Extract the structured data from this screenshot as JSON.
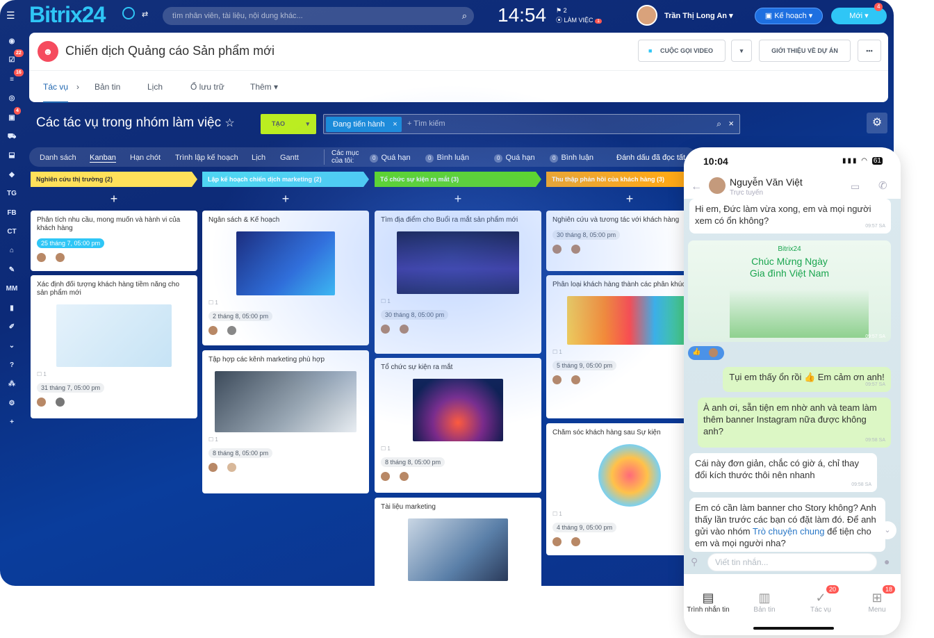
{
  "header": {
    "logo": "Bitrix24",
    "search_placeholder": "tìm nhân viên, tài liệu, nội dung khác...",
    "time": "14:54",
    "flag_count": "2",
    "workday": "LÀM VIỆC",
    "workday_badge": "1",
    "user_name": "Trần Thị Long An",
    "plan_label": "Kế hoạch",
    "new_label": "Mới",
    "new_badge": "4"
  },
  "sidebar": {
    "items": [
      {
        "label": "",
        "icon": "logo-icon"
      },
      {
        "label": "",
        "icon": "tasks-icon",
        "badge": "22"
      },
      {
        "label": "",
        "icon": "feed-icon",
        "badge": "16"
      },
      {
        "label": "",
        "icon": "target-icon"
      },
      {
        "label": "",
        "icon": "contacts-icon",
        "badge": "4"
      },
      {
        "label": "",
        "icon": "cart-icon"
      },
      {
        "label": "",
        "icon": "robot-icon"
      },
      {
        "label": "",
        "icon": "box-icon"
      },
      {
        "label": "TG"
      },
      {
        "label": "FB"
      },
      {
        "label": "CT"
      },
      {
        "label": "",
        "icon": "bank-icon"
      },
      {
        "label": "",
        "icon": "sign-icon"
      },
      {
        "label": "MM"
      },
      {
        "label": "",
        "icon": "chart-icon"
      },
      {
        "label": "",
        "icon": "edit-icon"
      },
      {
        "label": "",
        "icon": "chevron-icon"
      },
      {
        "label": "",
        "icon": "help-icon"
      },
      {
        "label": "",
        "icon": "network-icon"
      },
      {
        "label": "",
        "icon": "gear-icon"
      },
      {
        "label": "",
        "icon": "plus-icon"
      }
    ]
  },
  "group": {
    "title": "Chiến dịch Quảng cáo Sản phẩm mới",
    "video_call": "CUỘC GỌI VIDEO",
    "intro": "GIỚI THIỆU VỀ DỰ ÁN",
    "more": "•••",
    "tabs": [
      "Tác vụ",
      "Bản tin",
      "Lịch",
      "Ổ lưu trữ",
      "Thêm"
    ]
  },
  "tasks": {
    "title": "Các tác vụ trong nhóm làm việc",
    "create": "TẠO",
    "filter_chip": "Đang tiến hành",
    "filter_placeholder": "+ Tìm kiếm"
  },
  "views": {
    "items": [
      "Danh sách",
      "Kanban",
      "Hạn chót",
      "Trình lập kế hoạch",
      "Lịch",
      "Gantt"
    ],
    "my_items": "Các mục\ncủa tôi:",
    "counters": [
      {
        "num": "0",
        "label": "Quá hạn"
      },
      {
        "num": "0",
        "label": "Bình luận"
      },
      {
        "num": "0",
        "label": "Quá hạn"
      },
      {
        "num": "0",
        "label": "Bình luận"
      }
    ],
    "mark_read": "Đánh dấu đã đọc tất"
  },
  "columns": [
    {
      "title": "Nghiên cứu thị trường",
      "count": "(2)",
      "color": "#ffe15a",
      "cards": [
        {
          "title": "Phân tích nhu cầu, mong muốn và hành vi của khách hàng",
          "deadline": "25 tháng 7, 05:00 pm",
          "hot": true
        },
        {
          "title": "Xác định đối tượng khách hàng tiềm năng cho sản phẩm mới",
          "check": "1",
          "deadline": "31 tháng 7, 05:00 pm"
        }
      ]
    },
    {
      "title": "Lập kế hoạch chiến dịch marketing",
      "count": "(2)",
      "color": "#4fd5f2",
      "cards": [
        {
          "title": "Ngân sách & Kế hoạch",
          "check": "1",
          "deadline": "2 tháng 8, 05:00 pm"
        },
        {
          "title": "Tập hợp các kênh marketing phù hợp",
          "check": "1",
          "deadline": "8 tháng 8, 05:00 pm"
        }
      ]
    },
    {
      "title": "Tổ chức sự kiện ra mắt",
      "count": "(3)",
      "color": "#5fe010",
      "cards": [
        {
          "title": "Tìm địa điểm cho Buổi ra mắt sản phẩm mới",
          "check": "1",
          "deadline": "30 tháng 8, 05:00 pm"
        },
        {
          "title": "Tổ chức sự kiện ra mắt",
          "check": "1",
          "deadline": "8 tháng 8, 05:00 pm"
        },
        {
          "title": "Tài liệu marketing"
        }
      ]
    },
    {
      "title": "Thu thập phản hồi của khách hàng",
      "count": "(3)",
      "color": "#ffa918",
      "cards": [
        {
          "title": "Nghiên cứu và tương tác với khách hàng",
          "deadline": "30 tháng 8, 05:00 pm"
        },
        {
          "title": "Phân loại khách hàng thành các phân khúc",
          "check": "1",
          "deadline": "5 tháng 9, 05:00 pm"
        },
        {
          "title": "Chăm sóc khách hàng sau Sự kiện",
          "check": "1",
          "deadline": "4 tháng 9, 05:00 pm"
        }
      ]
    }
  ],
  "phone": {
    "time": "10:04",
    "status": "61",
    "contact": "Nguyễn Văn Việt",
    "contact_status": "Trực tuyến",
    "messages": [
      {
        "text": "Hi em, Đức làm vừa xong, em và mọi người xem có ổn không?",
        "time": "09:57 SA"
      },
      {
        "text": "Tụi em thấy ổn rồi 👍 Em cảm ơn anh!",
        "time": "09:57 SA",
        "me": true
      },
      {
        "text": "À anh ơi, sẵn tiện em nhờ anh và team làm thêm banner Instagram nữa được không anh?",
        "time": "09:58 SA",
        "me": true
      },
      {
        "text": "Cái này đơn giản, chắc có giờ á, chỉ thay đổi kích thước thôi nên nhanh",
        "time": "09:58 SA"
      },
      {
        "text_a": "Em có cần làm banner cho Story không? Anh thấy lần trước các bạn có đặt làm đó. Để anh gửi vào nhóm ",
        "link": "Trò chuyện chung",
        "text_b": " để tiện cho em và mọi người nha?"
      }
    ],
    "card": {
      "brand": "Bitrix24",
      "title": "Chúc Mừng Ngày\nGia đình Việt Nam",
      "time": "09:57 SA"
    },
    "input_placeholder": "Viết tin nhắn...",
    "nav": [
      {
        "label": "Trình nhắn tin",
        "icon": "chat-icon"
      },
      {
        "label": "Bản tin",
        "icon": "news-icon"
      },
      {
        "label": "Tác vụ",
        "icon": "task-icon",
        "badge": "20"
      },
      {
        "label": "Menu",
        "icon": "grid-icon",
        "badge": "18"
      }
    ]
  }
}
